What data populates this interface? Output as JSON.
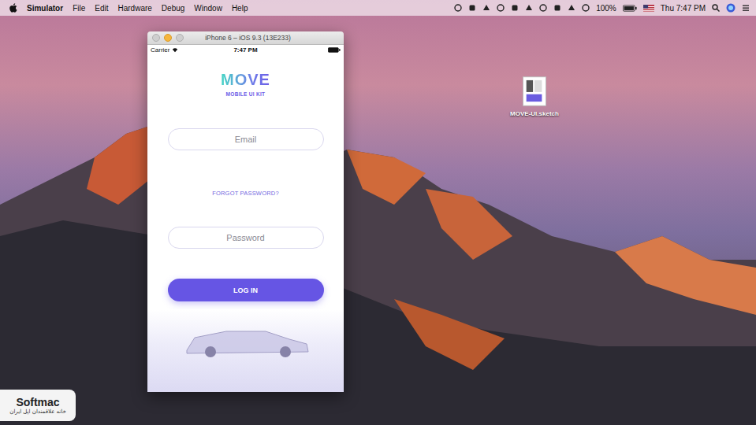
{
  "menu_bar": {
    "app": "Simulator",
    "items": [
      "File",
      "Edit",
      "Hardware",
      "Debug",
      "Window",
      "Help"
    ],
    "battery": "100%",
    "clock": "Thu 7:47 PM"
  },
  "simulator_window": {
    "title": "iPhone 6 – iOS 9.3 (13E233)",
    "status_bar": {
      "carrier": "Carrier",
      "time": "7:47 PM"
    },
    "logo": {
      "name": "MOVE",
      "subtitle": "MOBILE UI KIT"
    },
    "fields": [
      {
        "placeholder": "Email"
      },
      {
        "placeholder": "Password"
      }
    ],
    "forgot_link": "FORGOT PASSWORD?",
    "login_button": "LOG IN"
  },
  "desktop_icons": [
    {
      "label": "MOVE-UI.sketch"
    }
  ],
  "watermark": {
    "brand": "Softmac",
    "tagline": "خانه علاقمندان اپل ایران"
  }
}
